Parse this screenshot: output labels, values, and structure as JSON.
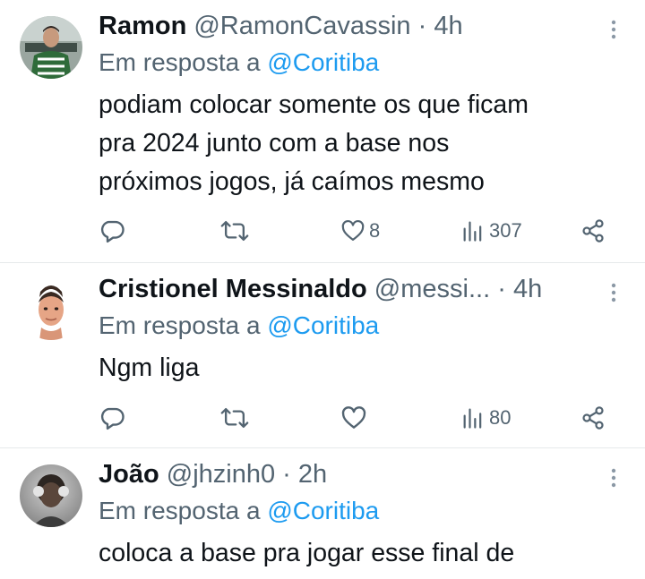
{
  "tweets": [
    {
      "name": "Ramon",
      "handle": "@RamonCavassin",
      "separator": "·",
      "time": "4h",
      "reply_prefix": "Em resposta a",
      "reply_mention": "@Coritiba",
      "text_lines": [
        "podiam colocar somente os que ficam",
        "pra 2024 junto com a base nos",
        "próximos jogos, já caímos mesmo"
      ],
      "like_count": "8",
      "view_count": "307",
      "icons": [
        "reply-icon",
        "retweet-icon",
        "heart-icon",
        "views-icon",
        "share-icon",
        "more-icon"
      ]
    },
    {
      "name": "Cristionel Messinaldo",
      "handle": "@messi...",
      "separator": "·",
      "time": "4h",
      "reply_prefix": "Em resposta a",
      "reply_mention": "@Coritiba",
      "text_lines": [
        "Ngm liga"
      ],
      "like_count": "",
      "view_count": "80",
      "icons": [
        "reply-icon",
        "retweet-icon",
        "heart-icon",
        "views-icon",
        "share-icon",
        "more-icon"
      ]
    },
    {
      "name": "João",
      "handle": "@jhzinh0",
      "separator": "·",
      "time": "2h",
      "reply_prefix": "Em resposta a",
      "reply_mention": "@Coritiba",
      "text_lines": [
        "coloca a base pra jogar esse final de"
      ],
      "icons": [
        "more-icon"
      ]
    }
  ],
  "colors": {
    "text_primary": "#0f1419",
    "text_secondary": "#536471",
    "mention": "#1d9bf0",
    "divider": "#e6e9eb"
  }
}
